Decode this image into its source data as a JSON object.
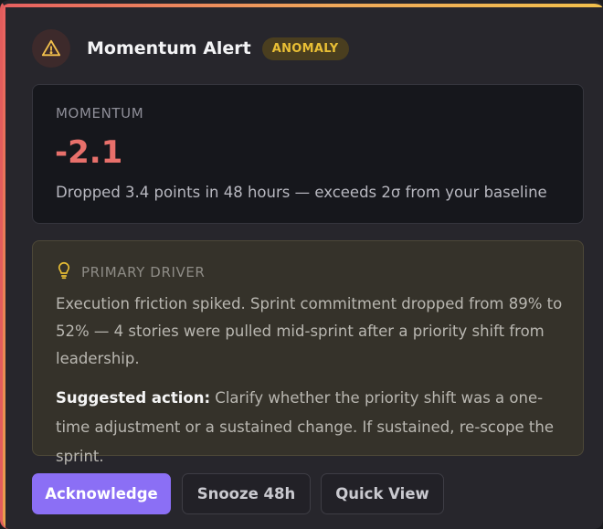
{
  "header": {
    "title": "Momentum Alert",
    "badge": "ANOMALY",
    "icon": "warning-triangle-icon"
  },
  "momentum": {
    "label": "MOMENTUM",
    "value": "-2.1",
    "description": "Dropped 3.4 points in 48 hours — exceeds 2σ from your baseline"
  },
  "driver": {
    "icon": "lightbulb-icon",
    "label": "PRIMARY DRIVER",
    "body": "Execution friction spiked. Sprint commitment dropped from 89% to 52% — 4 stories were pulled mid-sprint after a priority shift from leadership.",
    "action_label": "Suggested action:",
    "action_text": " Clarify whether the priority shift was a one-time adjustment or a sustained change. If sustained, re-scope the sprint."
  },
  "actions": {
    "acknowledge": "Acknowledge",
    "snooze": "Snooze 48h",
    "quick_view": "Quick View"
  },
  "colors": {
    "accent_red": "#e8706b",
    "badge_yellow": "#e9bf35",
    "primary_button": "#8b6ff5"
  }
}
